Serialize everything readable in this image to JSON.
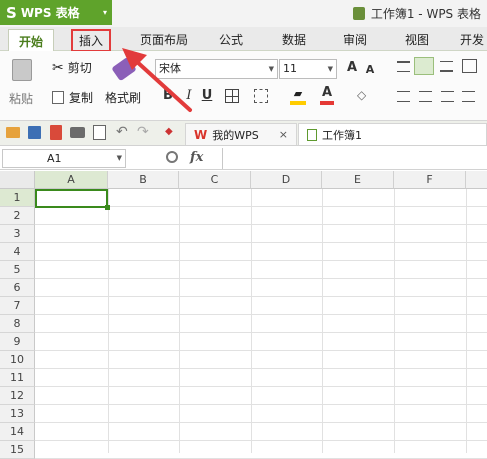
{
  "app": {
    "logo": "S",
    "name": "WPS 表格",
    "menu_arrow": "▾",
    "document_title": "工作簿1 - WPS 表格"
  },
  "tabs": [
    "开始",
    "插入",
    "页面布局",
    "公式",
    "数据",
    "审阅",
    "视图",
    "开发"
  ],
  "ribbon": {
    "paste": "粘贴",
    "cut": "剪切",
    "copy": "复制",
    "format_painter": "格式刷",
    "font_name": "宋体",
    "font_size": "11",
    "bold": "B",
    "italic": "I",
    "underline": "U",
    "grow_font": "A",
    "shrink_font": "A",
    "font_color": "A",
    "colors": {
      "font_color": "#e53935",
      "fill_color": "#ffcc00"
    }
  },
  "doc_tabs": {
    "my_wps": "我的WPS",
    "close": "×",
    "workbook": "工作簿1"
  },
  "formula_bar": {
    "cell_ref": "A1",
    "fx": "fx"
  },
  "sheet": {
    "columns": [
      "A",
      "B",
      "C",
      "D",
      "E",
      "F"
    ],
    "rows": [
      "1",
      "2",
      "3",
      "4",
      "5",
      "6",
      "7",
      "8",
      "9",
      "10",
      "11",
      "12",
      "13",
      "14",
      "15"
    ]
  },
  "annotation": {
    "color": "#e23b3b"
  }
}
